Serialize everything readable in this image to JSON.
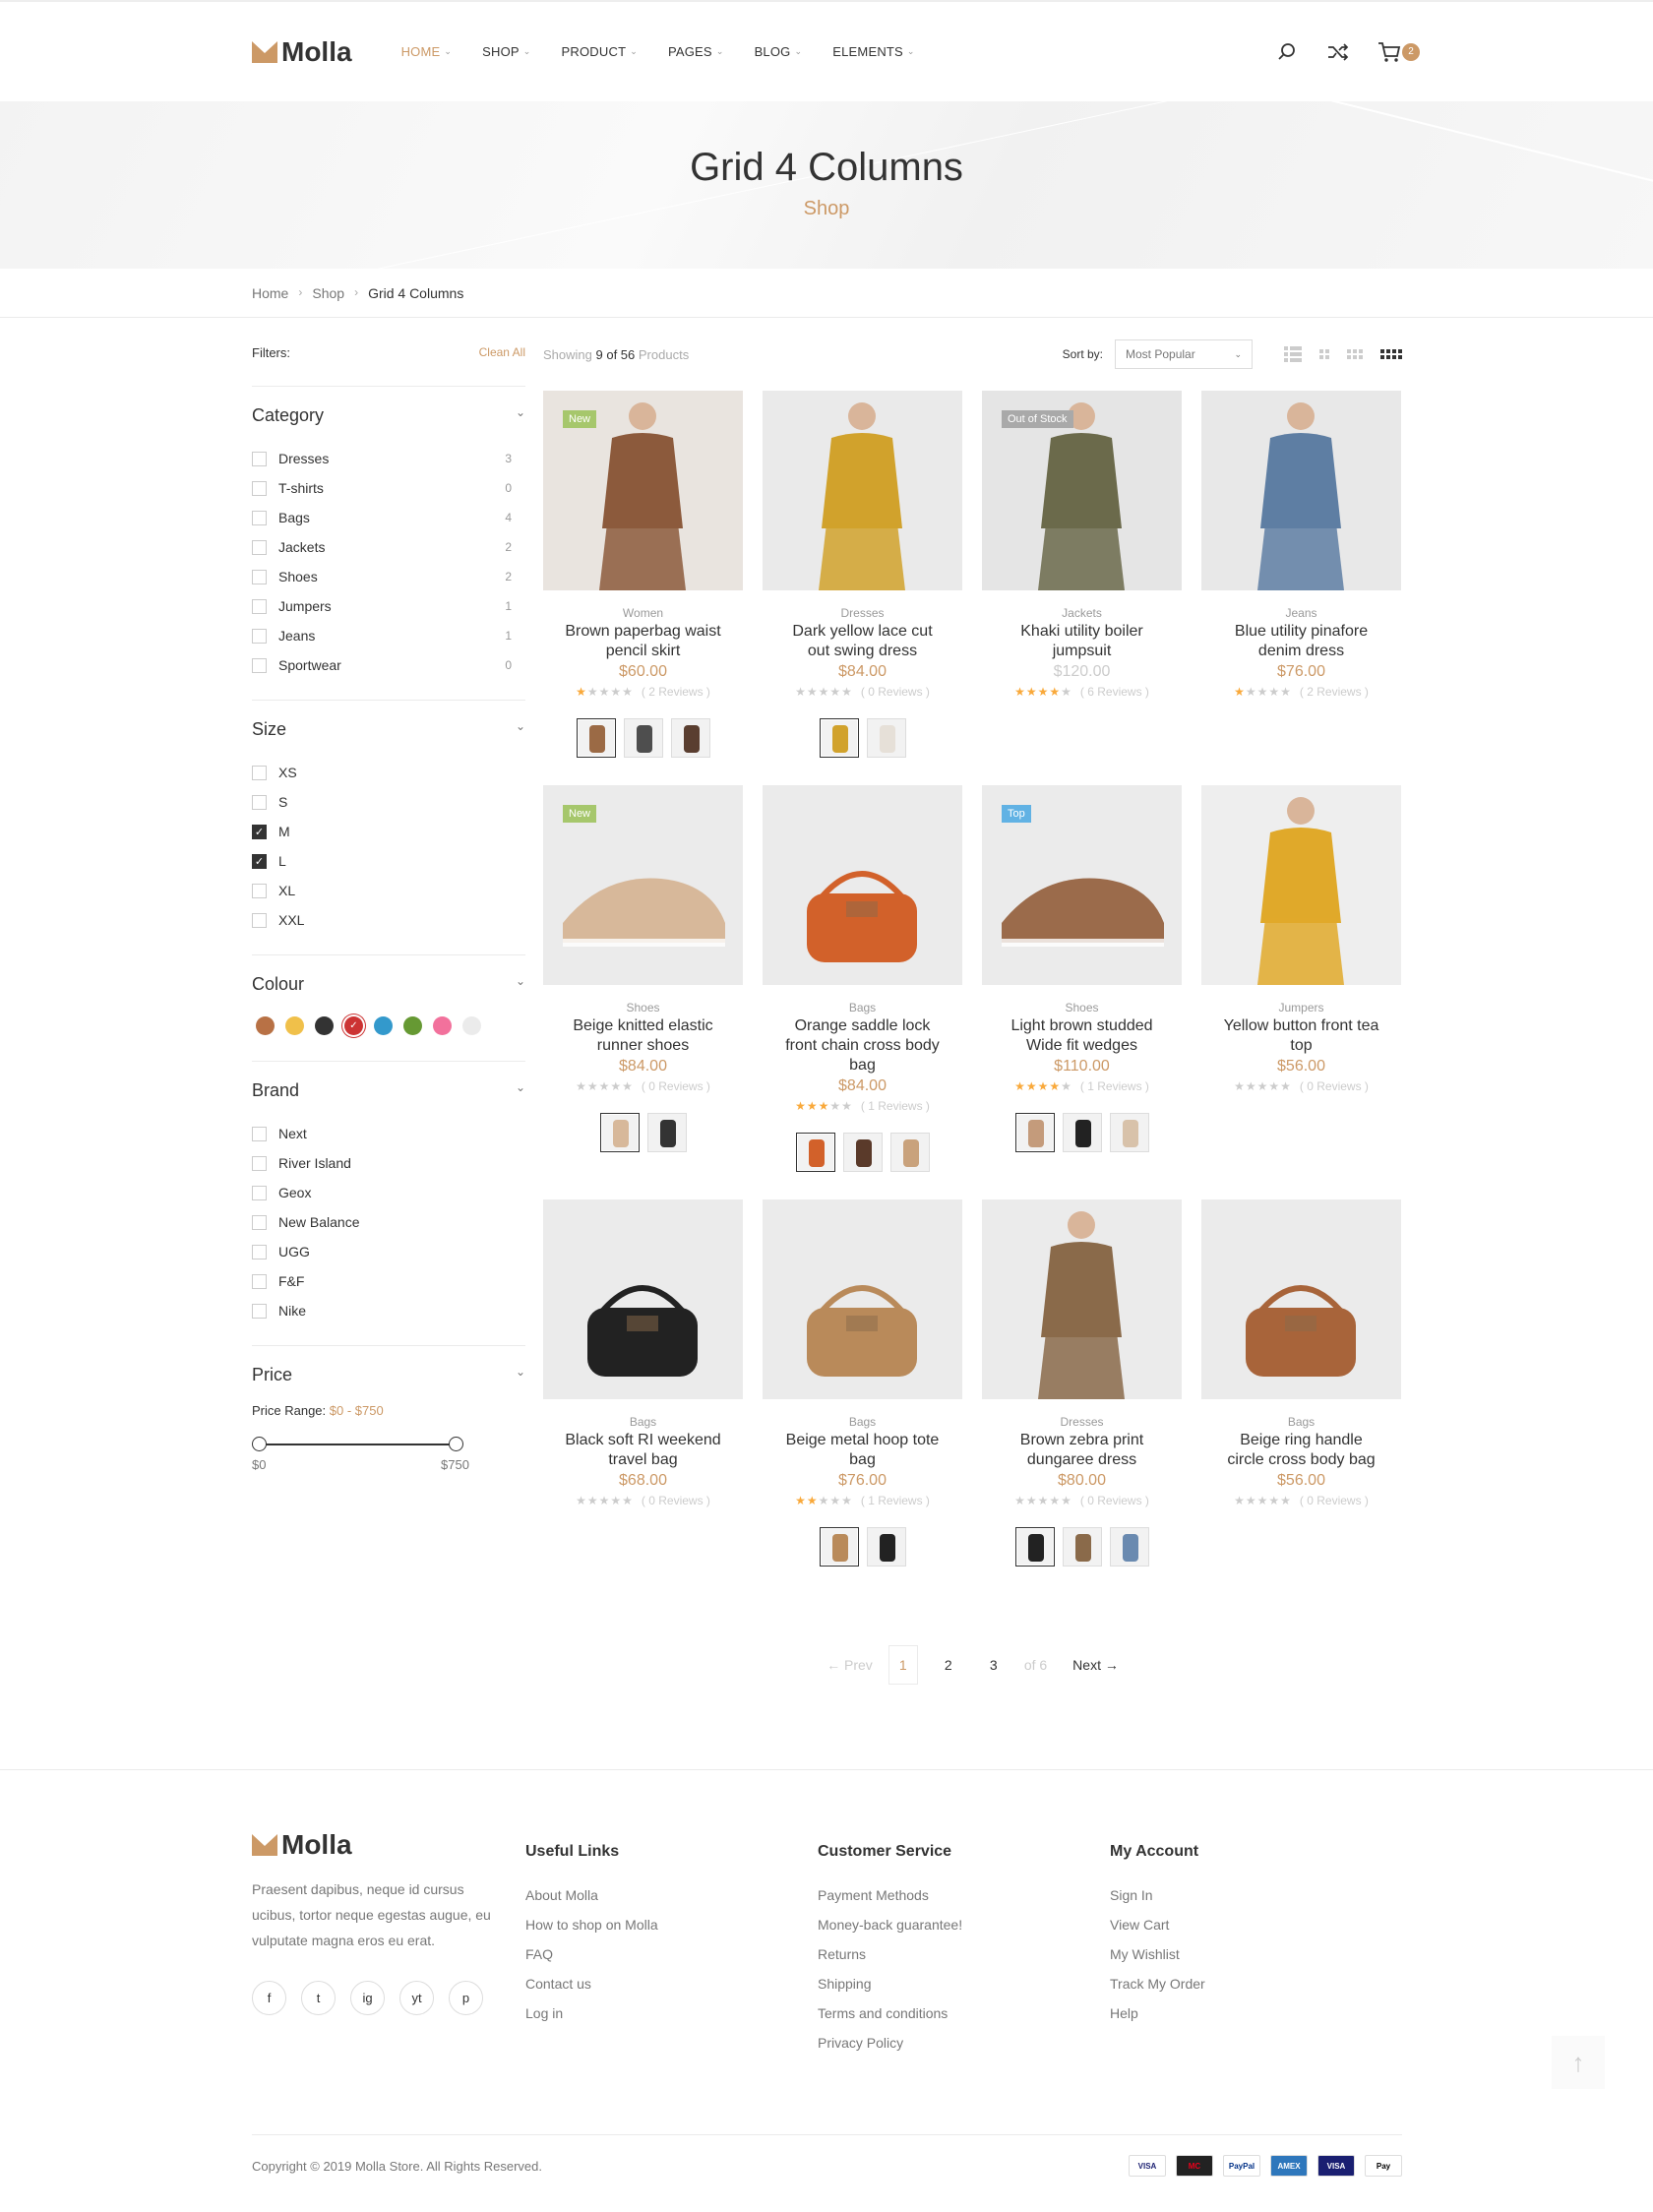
{
  "brand": {
    "name": "Molla"
  },
  "nav": [
    {
      "label": "Home",
      "active": true
    },
    {
      "label": "Shop"
    },
    {
      "label": "Product"
    },
    {
      "label": "Pages"
    },
    {
      "label": "Blog"
    },
    {
      "label": "Elements"
    }
  ],
  "header": {
    "cart_count": "2",
    "icons": [
      "search-icon",
      "compare-icon",
      "cart-icon"
    ]
  },
  "hero": {
    "title": "Grid 4 Columns",
    "subtitle": "Shop"
  },
  "breadcrumb": [
    "Home",
    "Shop",
    "Grid 4 Columns"
  ],
  "filters": {
    "label": "Filters:",
    "clean": "Clean All",
    "category": {
      "title": "Category",
      "items": [
        {
          "label": "Dresses",
          "count": "3"
        },
        {
          "label": "T-shirts",
          "count": "0"
        },
        {
          "label": "Bags",
          "count": "4"
        },
        {
          "label": "Jackets",
          "count": "2"
        },
        {
          "label": "Shoes",
          "count": "2"
        },
        {
          "label": "Jumpers",
          "count": "1"
        },
        {
          "label": "Jeans",
          "count": "1"
        },
        {
          "label": "Sportwear",
          "count": "0"
        }
      ]
    },
    "size": {
      "title": "Size",
      "items": [
        {
          "label": "XS",
          "checked": false
        },
        {
          "label": "S",
          "checked": false
        },
        {
          "label": "M",
          "checked": true
        },
        {
          "label": "L",
          "checked": true
        },
        {
          "label": "XL",
          "checked": false
        },
        {
          "label": "XXL",
          "checked": false
        }
      ]
    },
    "colour": {
      "title": "Colour",
      "swatches": [
        "#b87145",
        "#f0c04a",
        "#333333",
        "#cc3333",
        "#3399cc",
        "#669933",
        "#f2719c",
        "#ebebeb"
      ],
      "selected": 3
    },
    "brand": {
      "title": "Brand",
      "items": [
        "Next",
        "River Island",
        "Geox",
        "New Balance",
        "UGG",
        "F&F",
        "Nike"
      ]
    },
    "price": {
      "title": "Price",
      "range_label": "Price Range:",
      "range_value": "$0 - $750",
      "min_label": "$0",
      "max_label": "$750"
    }
  },
  "toolbox": {
    "showing_prefix": "Showing",
    "showing_count": "9 of 56",
    "showing_suffix": "Products",
    "sort_label": "Sort by:",
    "sort_value": "Most Popular"
  },
  "products": [
    {
      "cat": "Women",
      "name": "Brown paperbag waist pencil skirt",
      "price": "$60.00",
      "rating": 1,
      "reviews": "( 2 Reviews )",
      "badge": "New",
      "badge_color": "#a6c76c",
      "img": "#e9e4df",
      "fig": "#8c5a3c",
      "thumbs": [
        "#9b6a45",
        "#4e4e4e",
        "#5a3e30"
      ]
    },
    {
      "cat": "Dresses",
      "name": "Dark yellow lace cut out swing dress",
      "price": "$84.00",
      "rating": 0,
      "reviews": "( 0 Reviews )",
      "img": "#eaeaea",
      "fig": "#d1a22c",
      "thumbs": [
        "#d1a22c",
        "#e6e0d8"
      ]
    },
    {
      "cat": "Jackets",
      "name": "Khaki utility boiler jumpsuit",
      "price": "$120.00",
      "oos": true,
      "rating": 4,
      "reviews": "( 6 Reviews )",
      "badge": "Out of Stock",
      "badge_color": "#a9a9a9",
      "img": "#e5e5e5",
      "fig": "#6b6a4b"
    },
    {
      "cat": "Jeans",
      "name": "Blue utility pinafore denim dress",
      "price": "$76.00",
      "rating": 1,
      "reviews": "( 2 Reviews )",
      "img": "#e8e8e8",
      "fig": "#5e7ea3"
    },
    {
      "cat": "Shoes",
      "name": "Beige knitted elastic runner shoes",
      "price": "$84.00",
      "rating": 0,
      "reviews": "( 0 Reviews )",
      "badge": "New",
      "badge_color": "#a6c76c",
      "img": "#ebebeb",
      "fig": "#d7b89a",
      "thumbs": [
        "#d7b89a",
        "#333333"
      ]
    },
    {
      "cat": "Bags",
      "name": "Orange saddle lock front chain cross body bag",
      "price": "$84.00",
      "rating": 3,
      "reviews": "( 1 Reviews )",
      "img": "#ebebeb",
      "fig": "#d2612a",
      "thumbs": [
        "#d2612a",
        "#5a3a2a",
        "#c9a27c"
      ]
    },
    {
      "cat": "Shoes",
      "name": "Light brown studded Wide fit wedges",
      "price": "$110.00",
      "rating": 4,
      "reviews": "( 1 Reviews )",
      "badge": "Top",
      "badge_color": "#61b2e4",
      "img": "#ebebeb",
      "fig": "#9b6b4b",
      "thumbs": [
        "#c49b7b",
        "#222222",
        "#d8c2aa"
      ]
    },
    {
      "cat": "Jumpers",
      "name": "Yellow button front tea top",
      "price": "$56.00",
      "rating": 0,
      "reviews": "( 0 Reviews )",
      "img": "#eeeeee",
      "fig": "#e0a92a"
    },
    {
      "cat": "Bags",
      "name": "Black soft RI weekend travel bag",
      "price": "$68.00",
      "rating": 0,
      "reviews": "( 0 Reviews )",
      "img": "#ebebeb",
      "fig": "#222222"
    },
    {
      "cat": "Bags",
      "name": "Beige metal hoop tote bag",
      "price": "$76.00",
      "rating": 2,
      "reviews": "( 1 Reviews )",
      "img": "#ebebeb",
      "fig": "#b98a5a",
      "thumbs": [
        "#b98a5a",
        "#222222"
      ]
    },
    {
      "cat": "Dresses",
      "name": "Brown zebra print dungaree dress",
      "price": "$80.00",
      "rating": 0,
      "reviews": "( 0 Reviews )",
      "img": "#ebebeb",
      "fig": "#8a6a4a",
      "thumbs": [
        "#222222",
        "#8a6a4a",
        "#6a8ab0"
      ]
    },
    {
      "cat": "Bags",
      "name": "Beige ring handle circle cross body bag",
      "price": "$56.00",
      "rating": 0,
      "reviews": "( 0 Reviews )",
      "img": "#ebebeb",
      "fig": "#a8643a"
    }
  ],
  "pagination": {
    "prev": "Prev",
    "pages": [
      "1",
      "2",
      "3"
    ],
    "of": "of 6",
    "next": "Next"
  },
  "footer": {
    "about": "Praesent dapibus, neque id cursus ucibus, tortor neque egestas augue, eu vulputate magna eros eu erat.",
    "socials": [
      "f",
      "t",
      "ig",
      "yt",
      "p"
    ],
    "cols": [
      {
        "title": "Useful Links",
        "links": [
          "About Molla",
          "How to shop on Molla",
          "FAQ",
          "Contact us",
          "Log in"
        ]
      },
      {
        "title": "Customer Service",
        "links": [
          "Payment Methods",
          "Money-back guarantee!",
          "Returns",
          "Shipping",
          "Terms and conditions",
          "Privacy Policy"
        ]
      },
      {
        "title": "My Account",
        "links": [
          "Sign In",
          "View Cart",
          "My Wishlist",
          "Track My Order",
          "Help"
        ]
      }
    ],
    "copyright": "Copyright © 2019 Molla Store. All Rights Reserved.",
    "payments": [
      "VISA",
      "MC",
      "PayPal",
      "AMEX",
      "VISA",
      "Pay"
    ]
  }
}
